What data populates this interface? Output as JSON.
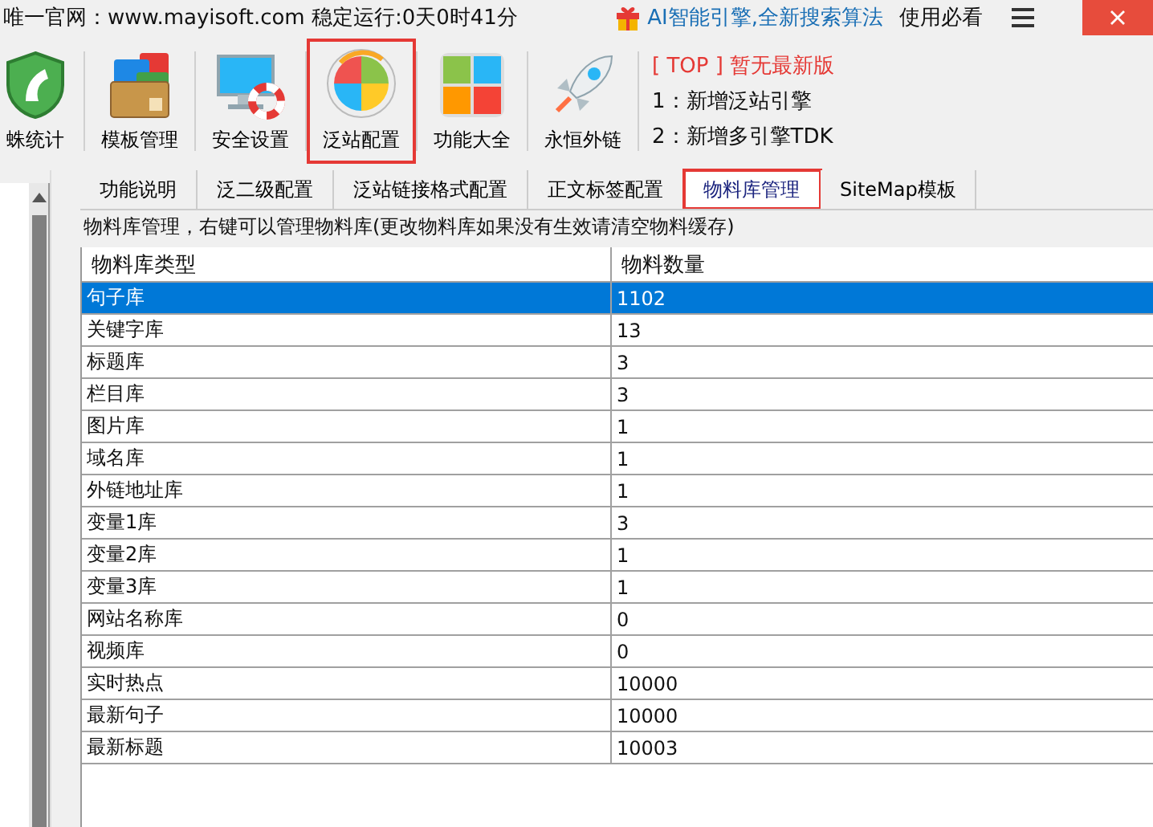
{
  "top_bar": {
    "site_text": "唯一官网：www.mayisoft.com 稳定运行:0天0时41分",
    "promo_link": "AI智能引擎,全新搜索算法",
    "help_link": "使用必看"
  },
  "toolbar": [
    {
      "kind": "shield",
      "label": "蛛统计",
      "highlighted": false
    },
    {
      "kind": "folder",
      "label": "模板管理",
      "highlighted": false
    },
    {
      "kind": "monitor",
      "label": "安全设置",
      "highlighted": false
    },
    {
      "kind": "refresh",
      "label": "泛站配置",
      "highlighted": true
    },
    {
      "kind": "tiles",
      "label": "功能大全",
      "highlighted": false
    },
    {
      "kind": "rocket",
      "label": "永恒外链",
      "highlighted": false
    }
  ],
  "news": {
    "headline": "[ TOP ] 暂无最新版",
    "items": [
      "1：新增泛站引擎",
      "2：新增多引擎TDK"
    ]
  },
  "tabs": [
    {
      "label": "功能说明",
      "selected": false,
      "highlighted": false
    },
    {
      "label": "泛二级配置",
      "selected": false,
      "highlighted": false
    },
    {
      "label": "泛站链接格式配置",
      "selected": false,
      "highlighted": false
    },
    {
      "label": "正文标签配置",
      "selected": false,
      "highlighted": false
    },
    {
      "label": "物料库管理",
      "selected": true,
      "highlighted": true
    },
    {
      "label": "SiteMap模板",
      "selected": false,
      "highlighted": false
    }
  ],
  "description": "物料库管理，右键可以管理物料库(更改物料库如果没有生效请清空物料缓存)",
  "table": {
    "columns": [
      "物料库类型",
      "物料数量"
    ],
    "rows": [
      {
        "cells": [
          "句子库",
          "1102"
        ],
        "selected": true
      },
      {
        "cells": [
          "关键字库",
          "13"
        ],
        "selected": false
      },
      {
        "cells": [
          "标题库",
          "3"
        ],
        "selected": false
      },
      {
        "cells": [
          "栏目库",
          "3"
        ],
        "selected": false
      },
      {
        "cells": [
          "图片库",
          "1"
        ],
        "selected": false
      },
      {
        "cells": [
          "域名库",
          "1"
        ],
        "selected": false
      },
      {
        "cells": [
          "外链地址库",
          "1"
        ],
        "selected": false
      },
      {
        "cells": [
          "变量1库",
          "3"
        ],
        "selected": false
      },
      {
        "cells": [
          "变量2库",
          "1"
        ],
        "selected": false
      },
      {
        "cells": [
          "变量3库",
          "1"
        ],
        "selected": false
      },
      {
        "cells": [
          "网站名称库",
          "0"
        ],
        "selected": false
      },
      {
        "cells": [
          "视频库",
          "0"
        ],
        "selected": false
      },
      {
        "cells": [
          "实时热点",
          "10000"
        ],
        "selected": false
      },
      {
        "cells": [
          "最新句子",
          "10000"
        ],
        "selected": false
      },
      {
        "cells": [
          "最新标题",
          "10003"
        ],
        "selected": false
      }
    ]
  }
}
